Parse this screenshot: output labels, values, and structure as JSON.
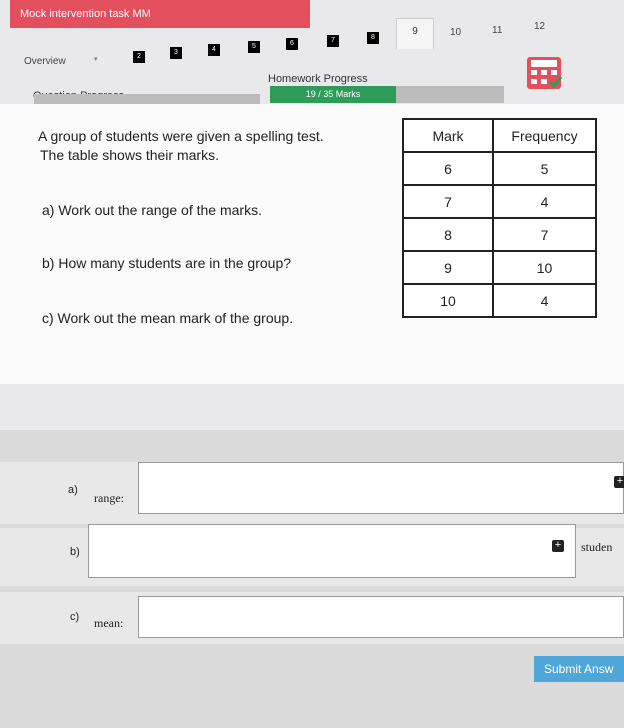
{
  "app": {
    "title": "Mock intervention task MM"
  },
  "nav": {
    "overview": "Overview",
    "tabs": [
      "2",
      "3",
      "4",
      "5",
      "6",
      "7",
      "8"
    ],
    "active_tab": "9",
    "plain_tabs": [
      "10",
      "11",
      "12"
    ]
  },
  "progress": {
    "question_label": "Question Progress",
    "homework_label": "Homework Progress",
    "homework_marks": "19 / 35 Marks",
    "homework_fraction": 0.54
  },
  "question": {
    "intro1": "A group of students were given a spelling test.",
    "intro2": "The table shows their marks.",
    "part_a": "a) Work out the range of the marks.",
    "part_b": "b) How many students are in the group?",
    "part_c": "c) Work out the mean mark of the group."
  },
  "table": {
    "headers": [
      "Mark",
      "Frequency"
    ],
    "rows": [
      [
        "6",
        "5"
      ],
      [
        "7",
        "4"
      ],
      [
        "8",
        "7"
      ],
      [
        "9",
        "10"
      ],
      [
        "10",
        "4"
      ]
    ]
  },
  "answers": {
    "a": {
      "letter": "a)",
      "label": "range:"
    },
    "b": {
      "letter": "b)",
      "unit": "studen"
    },
    "c": {
      "letter": "c)",
      "label": "mean:"
    }
  },
  "submit_label": "Submit Answ",
  "colors": {
    "title_bar": "#e34f5d",
    "homework_fill": "#2e9c58",
    "submit": "#4fa6d8"
  }
}
